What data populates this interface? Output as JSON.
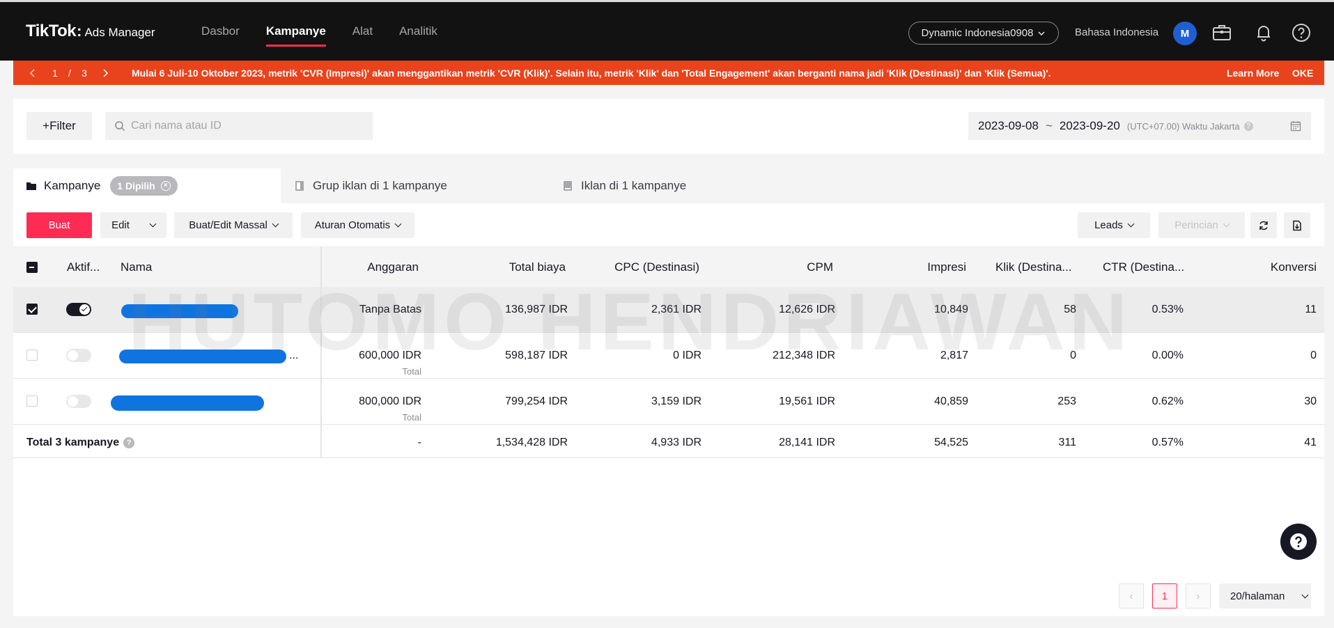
{
  "nav": {
    "logo_brand": "TikTok",
    "logo_colon": ":",
    "logo_product": "Ads Manager",
    "links": [
      "Dasbor",
      "Kampanye",
      "Alat",
      "Analitik"
    ],
    "account": "Dynamic Indonesia0908",
    "language": "Bahasa Indonesia",
    "avatar_initial": "M"
  },
  "banner": {
    "page_current": "1",
    "page_sep": "/",
    "page_total": "3",
    "message": "Mulai 6 Juli-10 Oktober 2023, metrik 'CVR (Impresi)' akan menggantikan metrik 'CVR (Klik)'. Selain itu, metrik 'Klik' dan 'Total Engagement' akan berganti nama jadi 'Klik (Destinasi)' dan 'Klik (Semua)'.",
    "learn_more": "Learn More",
    "ok": "OKE",
    "color": "#e8431d"
  },
  "filter": {
    "filter_label": "+Filter",
    "search_placeholder": "Cari nama atau ID",
    "date_start": "2023-09-08",
    "date_sep": "~",
    "date_end": "2023-09-20",
    "timezone": "(UTC+07.00) Waktu Jakarta",
    "info_glyph": "?"
  },
  "tabs": {
    "campaigns": "Kampanye",
    "selected_chip": "1 Dipilih",
    "chip_close": "×",
    "adgroups": "Grup iklan di 1 kampanye",
    "ads": "Iklan di 1 kampanye"
  },
  "toolbar": {
    "create": "Buat",
    "edit": "Edit",
    "bulk": "Buat/Edit Massal",
    "rules": "Aturan Otomatis",
    "leads": "Leads",
    "breakdown": "Perincian",
    "accent": "#fe2c55"
  },
  "table": {
    "headers": {
      "active": "Aktif...",
      "name": "Nama",
      "budget": "Anggaran",
      "cost": "Total biaya",
      "cpc": "CPC (Destinasi)",
      "cpm": "CPM",
      "impressions": "Impresi",
      "clicks": "Klik (Destina...",
      "ctr": "CTR (Destina...",
      "conversions": "Konversi"
    },
    "rows": [
      {
        "selected": true,
        "active": true,
        "name_suffix": "",
        "budget": "Tanpa Batas",
        "budget_sub": "",
        "cost": "136,987 IDR",
        "cpc": "2,361 IDR",
        "cpm": "12,626 IDR",
        "impressions": "10,849",
        "clicks": "58",
        "ctr": "0.53%",
        "conversions": "11"
      },
      {
        "selected": false,
        "active": false,
        "name_suffix": "...",
        "budget": "600,000 IDR",
        "budget_sub": "Total",
        "cost": "598,187 IDR",
        "cpc": "0 IDR",
        "cpm": "212,348 IDR",
        "impressions": "2,817",
        "clicks": "0",
        "ctr": "0.00%",
        "conversions": "0"
      },
      {
        "selected": false,
        "active": false,
        "name_suffix": "",
        "budget": "800,000 IDR",
        "budget_sub": "Total",
        "cost": "799,254 IDR",
        "cpc": "3,159 IDR",
        "cpm": "19,561 IDR",
        "impressions": "40,859",
        "clicks": "253",
        "ctr": "0.62%",
        "conversions": "30"
      }
    ],
    "total": {
      "label": "Total 3 kampanye",
      "help": "?",
      "budget": "-",
      "cost": "1,534,428 IDR",
      "cpc": "4,933 IDR",
      "cpm": "28,141 IDR",
      "impressions": "54,525",
      "clicks": "311",
      "ctr": "0.57%",
      "conversions": "41"
    }
  },
  "watermark": "HUTOMO HENDRIAWAN",
  "pagination": {
    "prev": "‹",
    "current": "1",
    "next": "›",
    "page_size": "20/halaman"
  }
}
